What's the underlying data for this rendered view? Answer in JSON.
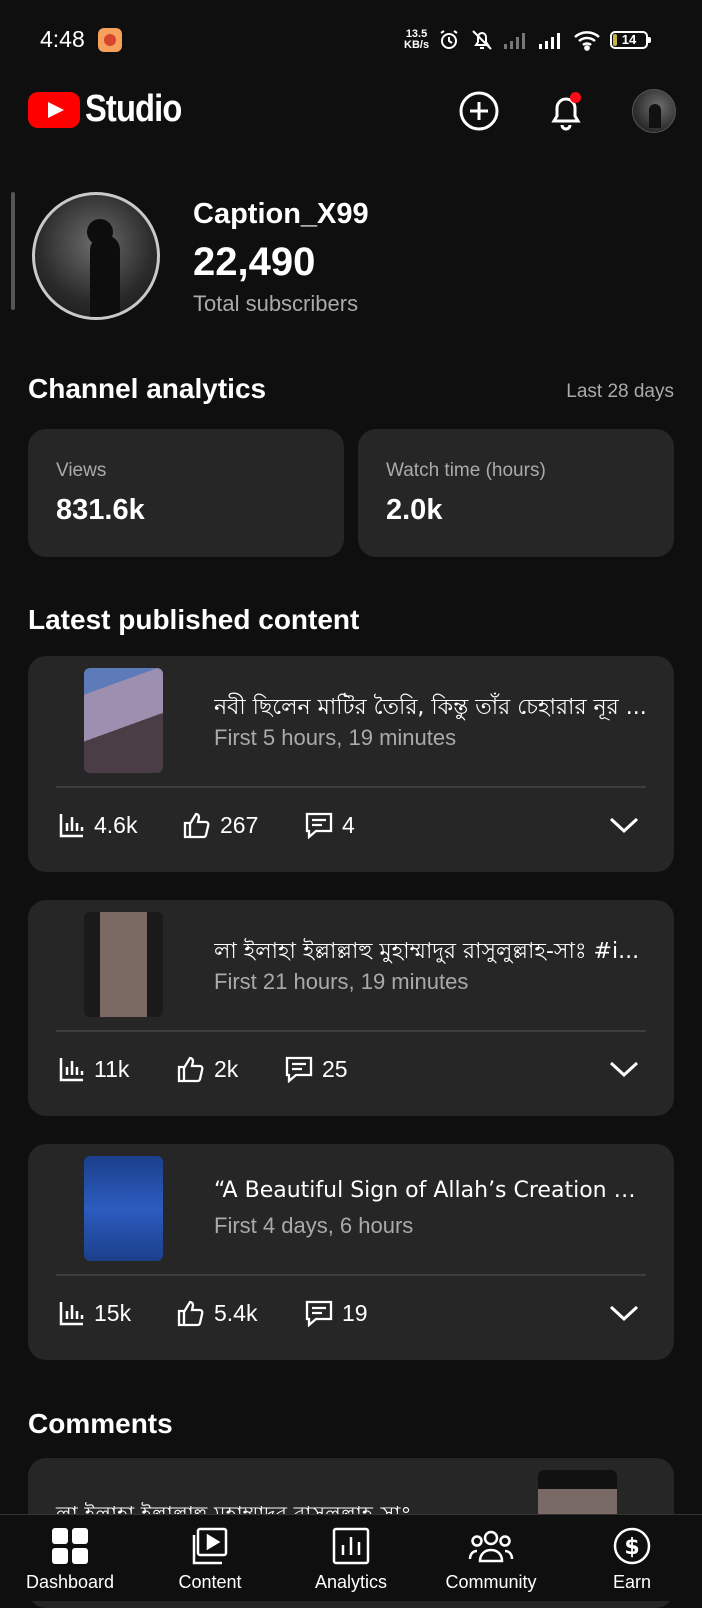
{
  "status_bar": {
    "time": "4:48",
    "net_speed_value": "13.5",
    "net_speed_unit": "KB/s",
    "battery": "14",
    "battery_level": 0.14
  },
  "header": {
    "logo_text": "Studio",
    "icons": [
      "create-icon",
      "notifications-icon",
      "account-avatar"
    ]
  },
  "channel": {
    "name": "Caption_X99",
    "subscribers": "22,490",
    "subscribers_label": "Total subscribers"
  },
  "analytics": {
    "title": "Channel analytics",
    "period": "Last 28 days",
    "cards": [
      {
        "label": "Views",
        "value": "831.6k"
      },
      {
        "label": "Watch time (hours)",
        "value": "2.0k"
      }
    ]
  },
  "latest": {
    "title": "Latest published content",
    "items": [
      {
        "title": "নবী ছিলেন মাটির তৈরি, কিন্তু তাঁর চেহারার নূর ...",
        "subtitle": "First 5 hours, 19 minutes",
        "views": "4.6k",
        "likes": "267",
        "comments": "4"
      },
      {
        "title": "লা ইলাহা ইল্লাল্লাহু মুহাম্মাদুর রাসুলুল্লাহ-সাঃ #i...",
        "subtitle": "First 21 hours, 19 minutes",
        "views": "11k",
        "likes": "2k",
        "comments": "25"
      },
      {
        "title": "“A Beautiful Sign of Allah’s Creation 🤍...",
        "subtitle": "First 4 days, 6 hours",
        "views": "15k",
        "likes": "5.4k",
        "comments": "19"
      }
    ]
  },
  "comments_section": {
    "title": "Comments",
    "first_comment": "লা ইলাহা ইল্লাল্লাহু মহাম্মাদর রাসলল্লাহ-সাঃ"
  },
  "bottom_nav": [
    {
      "label": "Dashboard",
      "icon": "dashboard-icon"
    },
    {
      "label": "Content",
      "icon": "content-icon"
    },
    {
      "label": "Analytics",
      "icon": "analytics-icon"
    },
    {
      "label": "Community",
      "icon": "community-icon"
    },
    {
      "label": "Earn",
      "icon": "earn-icon"
    }
  ],
  "colors": {
    "background": "#0f0f0f",
    "card": "#262626",
    "accent_red": "#ff0000",
    "secondary_text": "#aaaaaa"
  }
}
